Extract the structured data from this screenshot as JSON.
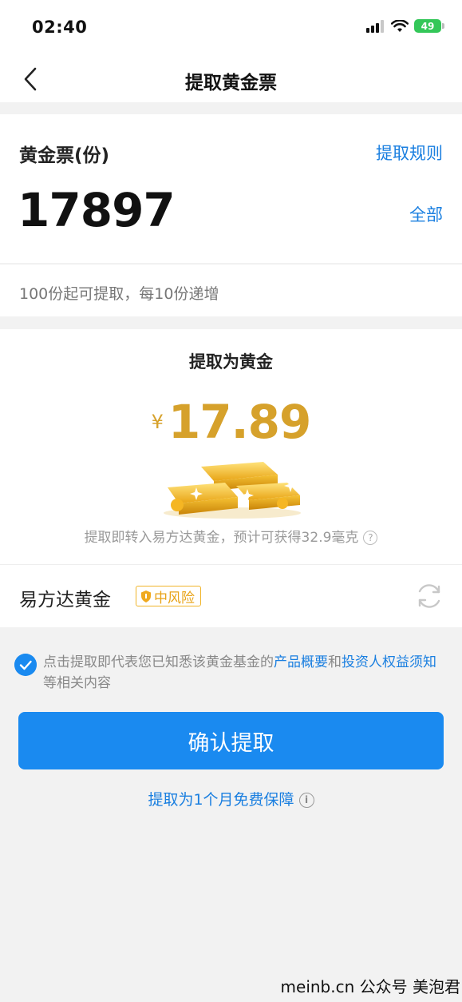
{
  "status_bar": {
    "time": "02:40",
    "battery": "49"
  },
  "nav": {
    "title": "提取黄金票"
  },
  "ticket": {
    "label": "黄金票(份)",
    "rules_link": "提取规则",
    "amount": "17897",
    "all_link": "全部",
    "hint": "100份起可提取，每10份递增"
  },
  "gold": {
    "title": "提取为黄金",
    "currency": "¥",
    "value": "17.89",
    "description": "提取即转入易方达黄金，预计可获得32.9毫克",
    "help": "?"
  },
  "fund": {
    "name": "易方达黄金",
    "risk": "中风险"
  },
  "agreement": {
    "prefix": "点击提取即代表您已知悉该黄金基金的",
    "link1": "产品概要",
    "middle": "和",
    "link2": "投资人权益须知",
    "suffix": "等相关内容"
  },
  "confirm_button": "确认提取",
  "guarantee": {
    "text": "提取为1个月免费保障",
    "info": "i"
  },
  "watermark": "meinb.cn  公众号 美泡君",
  "colors": {
    "accent": "#1a8af0",
    "link": "#1a7fe0",
    "gold": "#d6a12b",
    "risk": "#e8a317"
  }
}
